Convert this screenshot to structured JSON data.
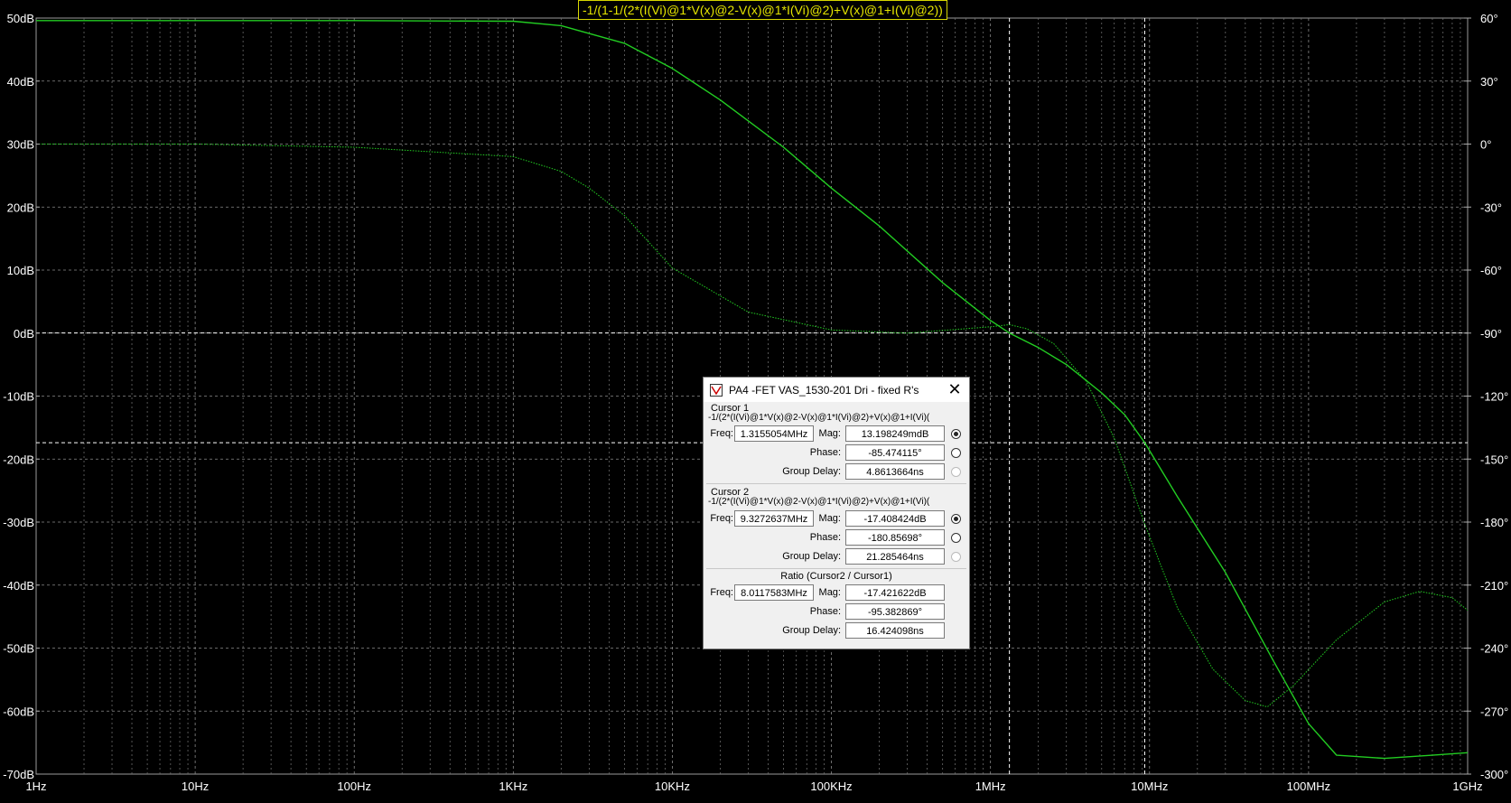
{
  "chart_data": {
    "type": "line",
    "title": "-1/(1-1/(2*(I(Vi)@1*V(x)@2-V(x)@1*I(Vi)@2)+V(x)@1+I(Vi)@2))",
    "x_scale": "log",
    "x_range_hz": [
      1,
      1000000000
    ],
    "x_ticks": [
      "1Hz",
      "10Hz",
      "100Hz",
      "1KHz",
      "10KHz",
      "100KHz",
      "1MHz",
      "10MHz",
      "100MHz",
      "1GHz"
    ],
    "y_left_ticks": [
      "50dB",
      "40dB",
      "30dB",
      "20dB",
      "10dB",
      "0dB",
      "-10dB",
      "-20dB",
      "-30dB",
      "-40dB",
      "-50dB",
      "-60dB",
      "-70dB"
    ],
    "y_left_range_db": [
      -70,
      50
    ],
    "y_right_ticks": [
      "60°",
      "30°",
      "0°",
      "-30°",
      "-60°",
      "-90°",
      "-120°",
      "-150°",
      "-180°",
      "-210°",
      "-240°",
      "-270°",
      "-300°"
    ],
    "y_right_range_deg": [
      -300,
      60
    ],
    "grid": true,
    "trace_color": "#22cc22",
    "series": [
      {
        "kind": "magnitude_db",
        "x": [
          1,
          10,
          100,
          1000,
          2000,
          5000,
          10000,
          20000,
          50000,
          100000,
          200000,
          500000,
          1000000,
          1315505,
          2000000,
          3000000,
          5000000,
          7000000,
          9327264,
          15000000,
          30000000,
          60000000,
          100000000,
          150000000,
          300000000,
          600000000,
          1000000000
        ],
        "y": [
          49.6,
          49.6,
          49.6,
          49.5,
          48.8,
          46,
          42,
          37,
          29.5,
          23,
          17,
          8,
          2,
          0.013,
          -2.3,
          -5,
          -9.5,
          -13,
          -17.4,
          -26,
          -38,
          -52,
          -62,
          -67,
          -67.5,
          -67,
          -66.6
        ]
      },
      {
        "kind": "phase_deg",
        "x": [
          1,
          10,
          100,
          1000,
          2000,
          3000,
          5000,
          10000,
          30000,
          100000,
          300000,
          1000000,
          1315505,
          1700000,
          2500000,
          4000000,
          6000000,
          9327264,
          15000000,
          25000000,
          40000000,
          55000000,
          80000000,
          150000000,
          300000000,
          500000000,
          800000000,
          1000000000
        ],
        "y": [
          0,
          0,
          -1.5,
          -6,
          -13,
          -21,
          -34,
          -59,
          -80,
          -88.5,
          -90,
          -87,
          -86,
          -88,
          -95,
          -113,
          -140,
          -181,
          -221,
          -250,
          -265,
          -268,
          -258,
          -236,
          -218,
          -213,
          -216,
          -222
        ]
      }
    ],
    "cursor1": {
      "freq_hz": 1315505,
      "mag_db": 0.013,
      "phase_deg": -85.474
    },
    "cursor2": {
      "freq_hz": 9327264,
      "mag_db": -17.408,
      "phase_deg": -180.857
    }
  },
  "dialog": {
    "title": "PA4 -FET VAS_1530-201 Dri - fixed R's",
    "close_icon": "close-icon",
    "logo_icon": "ltspice-logo-icon",
    "cursor1": {
      "label": "Cursor 1",
      "expression": "-1/(2*(I(Vi)@1*V(x)@2-V(x)@1*I(Vi)@2)+V(x)@1+I(Vi)(",
      "freq_label": "Freq:",
      "freq": "1.3155054MHz",
      "mag_label": "Mag:",
      "mag": "13.198249mdB",
      "phase_label": "Phase:",
      "phase": "-85.474115°",
      "gd_label": "Group Delay:",
      "gd": "4.8613664ns"
    },
    "cursor2": {
      "label": "Cursor 2",
      "expression": "-1/(2*(I(Vi)@1*V(x)@2-V(x)@1*I(Vi)@2)+V(x)@1+I(Vi)(",
      "freq_label": "Freq:",
      "freq": "9.3272637MHz",
      "mag_label": "Mag:",
      "mag": "-17.408424dB",
      "phase_label": "Phase:",
      "phase": "-180.85698°",
      "gd_label": "Group Delay:",
      "gd": "21.285464ns"
    },
    "ratio": {
      "label": "Ratio (Cursor2 / Cursor1)",
      "freq_label": "Freq:",
      "freq": "8.0117583MHz",
      "mag_label": "Mag:",
      "mag": "-17.421622dB",
      "phase_label": "Phase:",
      "phase": "-95.382869°",
      "gd_label": "Group Delay:",
      "gd": "16.424098ns"
    }
  }
}
